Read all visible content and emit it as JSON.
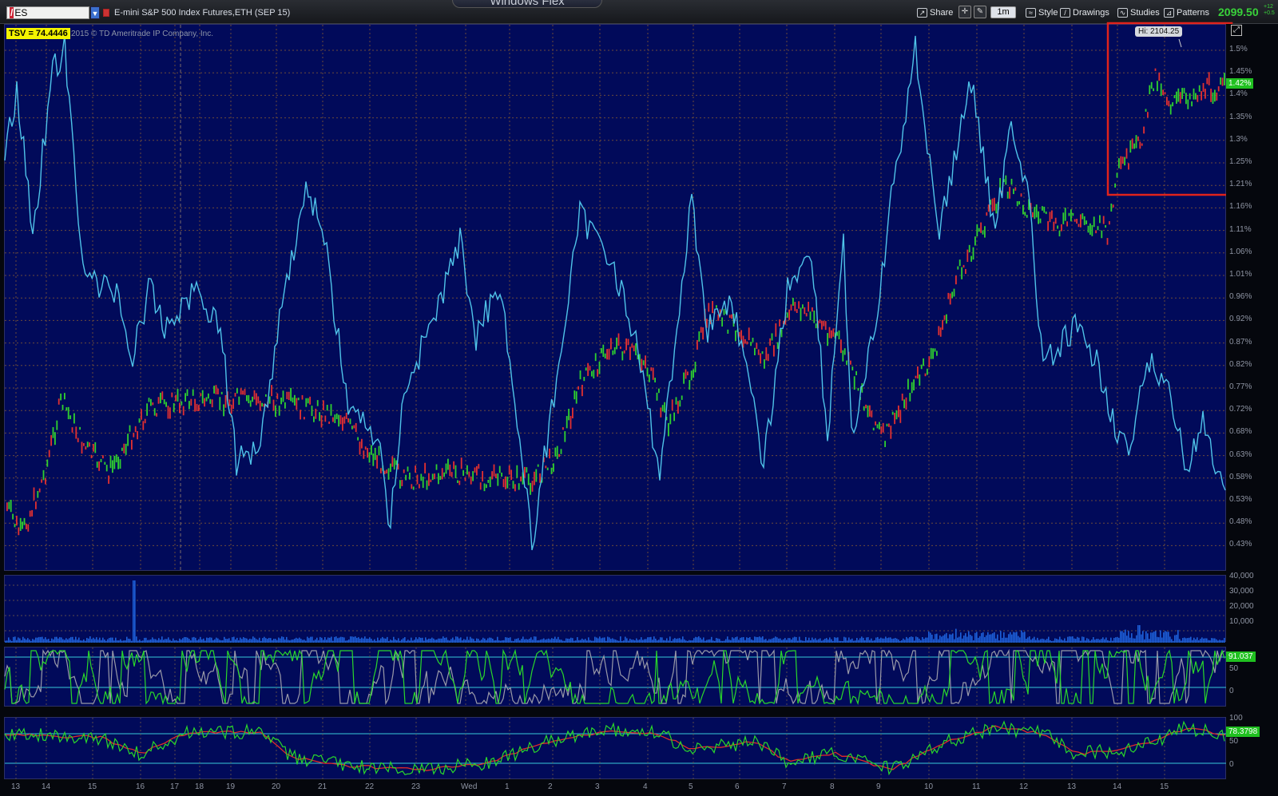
{
  "toolbar": {
    "symbol": "/ES",
    "symbol_prefix": "/",
    "symbol_code": "ES",
    "instrument": "E-mini S&P 500 Index Futures,ETH (SEP 15)",
    "window_title": "Windows Flex",
    "buttons": {
      "share": "Share",
      "timeframe": "1m",
      "style": "Style",
      "drawings": "Drawings",
      "studies": "Studies",
      "patterns": "Patterns"
    },
    "last_price": "2099.50",
    "change": "+12",
    "change2": "+0.5"
  },
  "price_panel": {
    "tsv_label": "TSV  = 74.4446",
    "copyright": "2015 © TD Ameritrade IP Company, Inc.",
    "hi_label": "Hi: 2104.25",
    "current_badge": "1.42%",
    "y_labels": [
      "1.5%",
      "1.45%",
      "1.4%",
      "1.35%",
      "1.3%",
      "1.25%",
      "1.21%",
      "1.16%",
      "1.11%",
      "1.06%",
      "1.01%",
      "0.96%",
      "0.92%",
      "0.87%",
      "0.82%",
      "0.77%",
      "0.72%",
      "0.68%",
      "0.63%",
      "0.58%",
      "0.53%",
      "0.48%",
      "0.43%"
    ]
  },
  "volume_panel": {
    "y_labels": [
      "40,000",
      "30,000",
      "20,000",
      "10,000"
    ]
  },
  "stoch_panel": {
    "badge": "91.037",
    "y_labels": [
      "50",
      "0"
    ]
  },
  "tsv_panel": {
    "badge": "78.3798",
    "y_labels": [
      "100",
      "50",
      "0"
    ]
  },
  "date_axis": [
    "13",
    "14",
    "15",
    "16",
    "17",
    "18",
    "19",
    "20",
    "21",
    "22",
    "23",
    "Wed",
    "1",
    "2",
    "3",
    "4",
    "5",
    "6",
    "7",
    "8",
    "9",
    "10",
    "11",
    "12",
    "13",
    "14",
    "15"
  ],
  "colors": {
    "panel_bg": "#010a5a",
    "price_up": "#2fd02f",
    "price_down": "#e23030",
    "indicator": "#4fc3e8",
    "highlight_box": "#e0231c"
  }
}
